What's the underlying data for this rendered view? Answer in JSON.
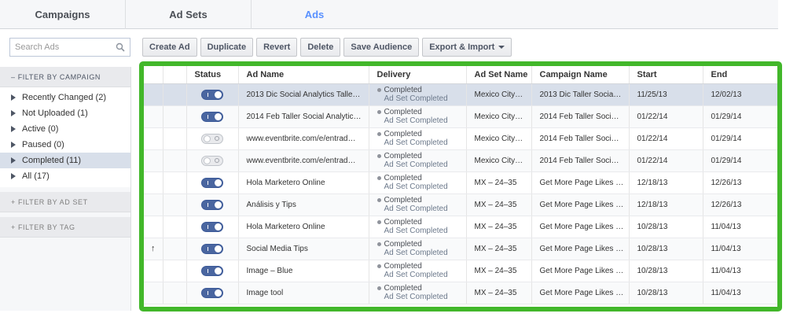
{
  "tabs": [
    {
      "label": "Campaigns",
      "active": false
    },
    {
      "label": "Ad Sets",
      "active": false
    },
    {
      "label": "Ads",
      "active": true
    }
  ],
  "search": {
    "placeholder": "Search Ads",
    "icon": "search-icon"
  },
  "toolbar": {
    "create_ad": "Create Ad",
    "duplicate": "Duplicate",
    "revert": "Revert",
    "delete": "Delete",
    "save_audience": "Save Audience",
    "export_import": "Export & Import"
  },
  "sidebar": {
    "campaign_header": "– FILTER BY CAMPAIGN",
    "items": [
      {
        "label": "Recently Changed (2)"
      },
      {
        "label": "Not Uploaded (1)"
      },
      {
        "label": "Active (0)"
      },
      {
        "label": "Paused (0)"
      },
      {
        "label": "Completed (11)",
        "selected": true
      },
      {
        "label": "All (17)"
      }
    ],
    "adset_header": "+ FILTER BY AD SET",
    "tag_header": "+ FILTER BY TAG"
  },
  "table": {
    "headers": {
      "status": "Status",
      "ad_name": "Ad Name",
      "delivery": "Delivery",
      "ad_set_name": "Ad Set Name",
      "campaign_name": "Campaign Name",
      "start": "Start",
      "end": "End"
    },
    "colors": {
      "toggle_on": "#4a66a0",
      "frame": "#42b72a",
      "selected_row": "#d8dfea"
    },
    "rows": [
      {
        "marker": "",
        "on": true,
        "ad_name": "2013 Dic Social Analytics Talle…",
        "delivery": "Completed",
        "delivery_sub": "Ad Set Completed",
        "ad_set": "Mexico City…",
        "campaign": "2013 Dic Taller Socia…",
        "start": "11/25/13",
        "end": "12/02/13"
      },
      {
        "marker": "",
        "on": true,
        "ad_name": "2014 Feb Taller Social Analytic…",
        "delivery": "Completed",
        "delivery_sub": "Ad Set Completed",
        "ad_set": "Mexico City…",
        "campaign": "2014 Feb Taller Soci…",
        "start": "01/22/14",
        "end": "01/29/14"
      },
      {
        "marker": "",
        "on": false,
        "ad_name": "www.eventbrite.com/e/entrad…",
        "delivery": "Completed",
        "delivery_sub": "Ad Set Completed",
        "ad_set": "Mexico City…",
        "campaign": "2014 Feb Taller Soci…",
        "start": "01/22/14",
        "end": "01/29/14"
      },
      {
        "marker": "",
        "on": false,
        "ad_name": "www.eventbrite.com/e/entrad…",
        "delivery": "Completed",
        "delivery_sub": "Ad Set Completed",
        "ad_set": "Mexico City…",
        "campaign": "2014 Feb Taller Soci…",
        "start": "01/22/14",
        "end": "01/29/14"
      },
      {
        "marker": "",
        "on": true,
        "ad_name": "Hola Marketero Online",
        "delivery": "Completed",
        "delivery_sub": "Ad Set Completed",
        "ad_set": "MX – 24–35",
        "campaign": "Get More Page Likes …",
        "start": "12/18/13",
        "end": "12/26/13"
      },
      {
        "marker": "",
        "on": true,
        "ad_name": "Análisis y Tips",
        "delivery": "Completed",
        "delivery_sub": "Ad Set Completed",
        "ad_set": "MX – 24–35",
        "campaign": "Get More Page Likes …",
        "start": "12/18/13",
        "end": "12/26/13"
      },
      {
        "marker": "",
        "on": true,
        "ad_name": "Hola Marketero Online",
        "delivery": "Completed",
        "delivery_sub": "Ad Set Completed",
        "ad_set": "MX – 24–35",
        "campaign": "Get More Page Likes …",
        "start": "10/28/13",
        "end": "11/04/13"
      },
      {
        "marker": "↑",
        "on": true,
        "ad_name": "Social Media Tips",
        "delivery": "Completed",
        "delivery_sub": "Ad Set Completed",
        "ad_set": "MX – 24–35",
        "campaign": "Get More Page Likes …",
        "start": "10/28/13",
        "end": "11/04/13"
      },
      {
        "marker": "",
        "on": true,
        "ad_name": "Image – Blue",
        "delivery": "Completed",
        "delivery_sub": "Ad Set Completed",
        "ad_set": "MX – 24–35",
        "campaign": "Get More Page Likes …",
        "start": "10/28/13",
        "end": "11/04/13"
      },
      {
        "marker": "",
        "on": true,
        "ad_name": "Image tool",
        "delivery": "Completed",
        "delivery_sub": "Ad Set Completed",
        "ad_set": "MX – 24–35",
        "campaign": "Get More Page Likes …",
        "start": "10/28/13",
        "end": "11/04/13"
      }
    ]
  }
}
